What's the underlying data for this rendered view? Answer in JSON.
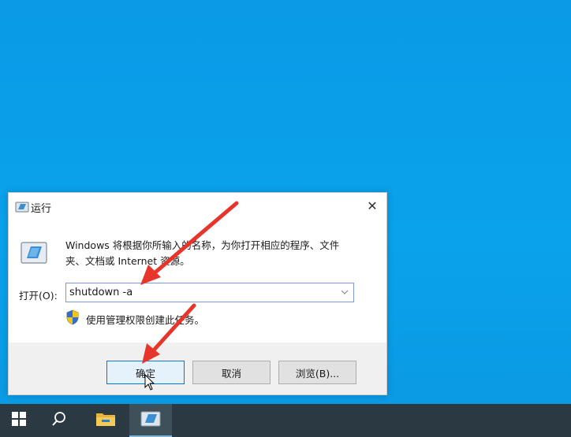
{
  "dialog": {
    "title": "运行",
    "close_glyph": "✕",
    "description": "Windows 将根据你所输入的名称，为你打开相应的程序、文件夹、文档或 Internet 资源。",
    "open_label": "打开(O):",
    "open_value": "shutdown -a",
    "admin_note": "使用管理权限创建此任务。",
    "buttons": {
      "ok": "确定",
      "cancel": "取消",
      "browse": "浏览(B)..."
    }
  },
  "icons": {
    "title": "run-app-icon",
    "main": "run-app-icon",
    "shield": "uac-shield-icon",
    "dropdown": "chevron-down-icon",
    "cursor": "mouse-pointer-icon"
  },
  "taskbar": {
    "items": [
      "windows-start-icon",
      "search-icon",
      "file-explorer-icon",
      "run-app-icon"
    ]
  },
  "colors": {
    "desktop": "#0aa2eb",
    "taskbar": "#2b3a42",
    "annotation_arrow": "#e8352b",
    "focus_border": "#0078d7"
  }
}
